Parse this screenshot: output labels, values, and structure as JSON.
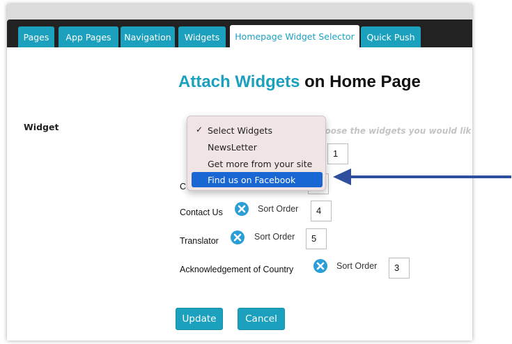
{
  "tabs": [
    {
      "label": "Pages",
      "active": false
    },
    {
      "label": "App Pages",
      "active": false
    },
    {
      "label": "Navigation",
      "active": false
    },
    {
      "label": "Widgets",
      "active": false
    },
    {
      "label": "Homepage Widget Selector",
      "active": true
    },
    {
      "label": "Quick Push",
      "active": false
    }
  ],
  "heading": {
    "accent": "Attach Widgets",
    "rest": "on Home Page"
  },
  "widget_label": "Widget",
  "hint": "hoose the widgets you would lik",
  "dropdown": {
    "options": [
      {
        "label": "Select Widgets",
        "checked": true
      },
      {
        "label": "NewsLetter"
      },
      {
        "label": "Get more from your site"
      },
      {
        "label": "Find us on Facebook",
        "highlighted": true
      }
    ]
  },
  "widgets": [
    {
      "label": "Contact Us",
      "sort_label": "Sort Order",
      "sort_value": "4"
    },
    {
      "label": "Translator",
      "sort_label": "Sort Order",
      "sort_value": "5"
    },
    {
      "label": "Acknowledgement of Country",
      "sort_label": "Sort Order",
      "sort_value": "3"
    }
  ],
  "hidden_rows": {
    "first_sort_value": "1",
    "second_row_label_fragment": "C"
  },
  "buttons": {
    "update": "Update",
    "cancel": "Cancel"
  },
  "icons": {
    "remove": "close-circle-icon",
    "check": "checkmark-icon",
    "pointer": "arrow-left-icon"
  },
  "colors": {
    "accent": "#1ba1bd",
    "highlight": "#1967d2",
    "arrow": "#2d4f9e",
    "remove": "#2a9fd6"
  }
}
